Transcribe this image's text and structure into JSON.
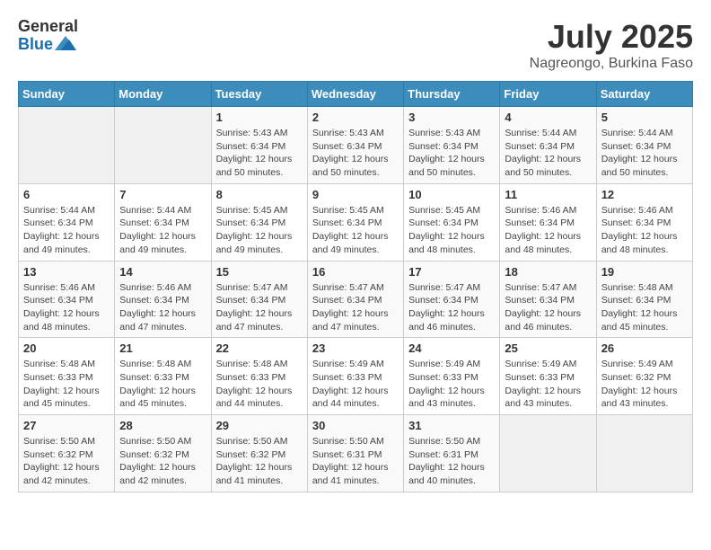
{
  "header": {
    "logo_general": "General",
    "logo_blue": "Blue",
    "month_title": "July 2025",
    "location": "Nagreongo, Burkina Faso"
  },
  "calendar": {
    "days_of_week": [
      "Sunday",
      "Monday",
      "Tuesday",
      "Wednesday",
      "Thursday",
      "Friday",
      "Saturday"
    ],
    "weeks": [
      [
        {
          "day": "",
          "info": ""
        },
        {
          "day": "",
          "info": ""
        },
        {
          "day": "1",
          "info": "Sunrise: 5:43 AM\nSunset: 6:34 PM\nDaylight: 12 hours and 50 minutes."
        },
        {
          "day": "2",
          "info": "Sunrise: 5:43 AM\nSunset: 6:34 PM\nDaylight: 12 hours and 50 minutes."
        },
        {
          "day": "3",
          "info": "Sunrise: 5:43 AM\nSunset: 6:34 PM\nDaylight: 12 hours and 50 minutes."
        },
        {
          "day": "4",
          "info": "Sunrise: 5:44 AM\nSunset: 6:34 PM\nDaylight: 12 hours and 50 minutes."
        },
        {
          "day": "5",
          "info": "Sunrise: 5:44 AM\nSunset: 6:34 PM\nDaylight: 12 hours and 50 minutes."
        }
      ],
      [
        {
          "day": "6",
          "info": "Sunrise: 5:44 AM\nSunset: 6:34 PM\nDaylight: 12 hours and 49 minutes."
        },
        {
          "day": "7",
          "info": "Sunrise: 5:44 AM\nSunset: 6:34 PM\nDaylight: 12 hours and 49 minutes."
        },
        {
          "day": "8",
          "info": "Sunrise: 5:45 AM\nSunset: 6:34 PM\nDaylight: 12 hours and 49 minutes."
        },
        {
          "day": "9",
          "info": "Sunrise: 5:45 AM\nSunset: 6:34 PM\nDaylight: 12 hours and 49 minutes."
        },
        {
          "day": "10",
          "info": "Sunrise: 5:45 AM\nSunset: 6:34 PM\nDaylight: 12 hours and 48 minutes."
        },
        {
          "day": "11",
          "info": "Sunrise: 5:46 AM\nSunset: 6:34 PM\nDaylight: 12 hours and 48 minutes."
        },
        {
          "day": "12",
          "info": "Sunrise: 5:46 AM\nSunset: 6:34 PM\nDaylight: 12 hours and 48 minutes."
        }
      ],
      [
        {
          "day": "13",
          "info": "Sunrise: 5:46 AM\nSunset: 6:34 PM\nDaylight: 12 hours and 48 minutes."
        },
        {
          "day": "14",
          "info": "Sunrise: 5:46 AM\nSunset: 6:34 PM\nDaylight: 12 hours and 47 minutes."
        },
        {
          "day": "15",
          "info": "Sunrise: 5:47 AM\nSunset: 6:34 PM\nDaylight: 12 hours and 47 minutes."
        },
        {
          "day": "16",
          "info": "Sunrise: 5:47 AM\nSunset: 6:34 PM\nDaylight: 12 hours and 47 minutes."
        },
        {
          "day": "17",
          "info": "Sunrise: 5:47 AM\nSunset: 6:34 PM\nDaylight: 12 hours and 46 minutes."
        },
        {
          "day": "18",
          "info": "Sunrise: 5:47 AM\nSunset: 6:34 PM\nDaylight: 12 hours and 46 minutes."
        },
        {
          "day": "19",
          "info": "Sunrise: 5:48 AM\nSunset: 6:34 PM\nDaylight: 12 hours and 45 minutes."
        }
      ],
      [
        {
          "day": "20",
          "info": "Sunrise: 5:48 AM\nSunset: 6:33 PM\nDaylight: 12 hours and 45 minutes."
        },
        {
          "day": "21",
          "info": "Sunrise: 5:48 AM\nSunset: 6:33 PM\nDaylight: 12 hours and 45 minutes."
        },
        {
          "day": "22",
          "info": "Sunrise: 5:48 AM\nSunset: 6:33 PM\nDaylight: 12 hours and 44 minutes."
        },
        {
          "day": "23",
          "info": "Sunrise: 5:49 AM\nSunset: 6:33 PM\nDaylight: 12 hours and 44 minutes."
        },
        {
          "day": "24",
          "info": "Sunrise: 5:49 AM\nSunset: 6:33 PM\nDaylight: 12 hours and 43 minutes."
        },
        {
          "day": "25",
          "info": "Sunrise: 5:49 AM\nSunset: 6:33 PM\nDaylight: 12 hours and 43 minutes."
        },
        {
          "day": "26",
          "info": "Sunrise: 5:49 AM\nSunset: 6:32 PM\nDaylight: 12 hours and 43 minutes."
        }
      ],
      [
        {
          "day": "27",
          "info": "Sunrise: 5:50 AM\nSunset: 6:32 PM\nDaylight: 12 hours and 42 minutes."
        },
        {
          "day": "28",
          "info": "Sunrise: 5:50 AM\nSunset: 6:32 PM\nDaylight: 12 hours and 42 minutes."
        },
        {
          "day": "29",
          "info": "Sunrise: 5:50 AM\nSunset: 6:32 PM\nDaylight: 12 hours and 41 minutes."
        },
        {
          "day": "30",
          "info": "Sunrise: 5:50 AM\nSunset: 6:31 PM\nDaylight: 12 hours and 41 minutes."
        },
        {
          "day": "31",
          "info": "Sunrise: 5:50 AM\nSunset: 6:31 PM\nDaylight: 12 hours and 40 minutes."
        },
        {
          "day": "",
          "info": ""
        },
        {
          "day": "",
          "info": ""
        }
      ]
    ]
  }
}
